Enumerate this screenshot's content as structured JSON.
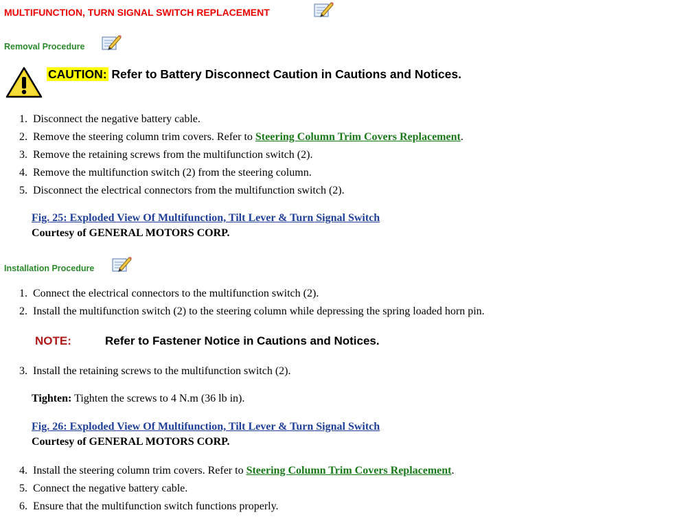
{
  "document": {
    "title": "MULTIFUNCTION, TURN SIGNAL SWITCH REPLACEMENT"
  },
  "removal": {
    "heading": "Removal Procedure",
    "caution_label": "CAUTION:",
    "caution_text": "Refer to Battery Disconnect Caution in Cautions and Notices.",
    "steps": [
      {
        "num": "1.",
        "text": "Disconnect the negative battery cable."
      },
      {
        "num": "2.",
        "text": "Remove the steering column trim covers. Refer to ",
        "link": "Steering Column Trim Covers Replacement",
        "after": "."
      },
      {
        "num": "3.",
        "text": "Remove the retaining screws from the multifunction switch (2)."
      },
      {
        "num": "4.",
        "text": "Remove the multifunction switch (2) from the steering column."
      },
      {
        "num": "5.",
        "text": "Disconnect the electrical connectors from the multifunction switch (2)."
      }
    ],
    "figure_link": "Fig. 25: Exploded View Of Multifunction, Tilt Lever & Turn Signal Switch",
    "courtesy": "Courtesy of GENERAL MOTORS CORP."
  },
  "installation": {
    "heading": "Installation Procedure",
    "steps": [
      {
        "num": "1.",
        "text": "Connect the electrical connectors to the multifunction switch (2)."
      },
      {
        "num": "2.",
        "text": "Install the multifunction switch (2) to the steering column while depressing the spring loaded horn pin."
      },
      {
        "num": "3.",
        "text": "Install the retaining screws to the multifunction switch (2)."
      },
      {
        "num": "4.",
        "text": "Install the steering column trim covers. Refer to ",
        "link": "Steering Column Trim Covers Replacement",
        "after": "."
      },
      {
        "num": "5.",
        "text": "Connect the negative battery cable."
      },
      {
        "num": "6.",
        "text": "Ensure that the multifunction switch functions properly."
      }
    ],
    "note_label": "NOTE:",
    "note_text": "Refer to Fastener Notice in Cautions and Notices.",
    "tighten_label": "Tighten:",
    "tighten_text": " Tighten the screws to 4 N.m (36 lb in).",
    "figure_link": "Fig. 26: Exploded View Of Multifunction, Tilt Lever & Turn Signal Switch",
    "courtesy": "Courtesy of GENERAL MOTORS CORP."
  },
  "icons": {
    "edit": "edit-pencil-icon",
    "caution": "warning-triangle-icon"
  },
  "colors": {
    "title": "#ee0000",
    "section_heading": "#2a8a2a",
    "link": "#1a7a1a",
    "figure_link": "#1f3f99",
    "caution_highlight": "#ffff00",
    "note": "#b01818"
  }
}
